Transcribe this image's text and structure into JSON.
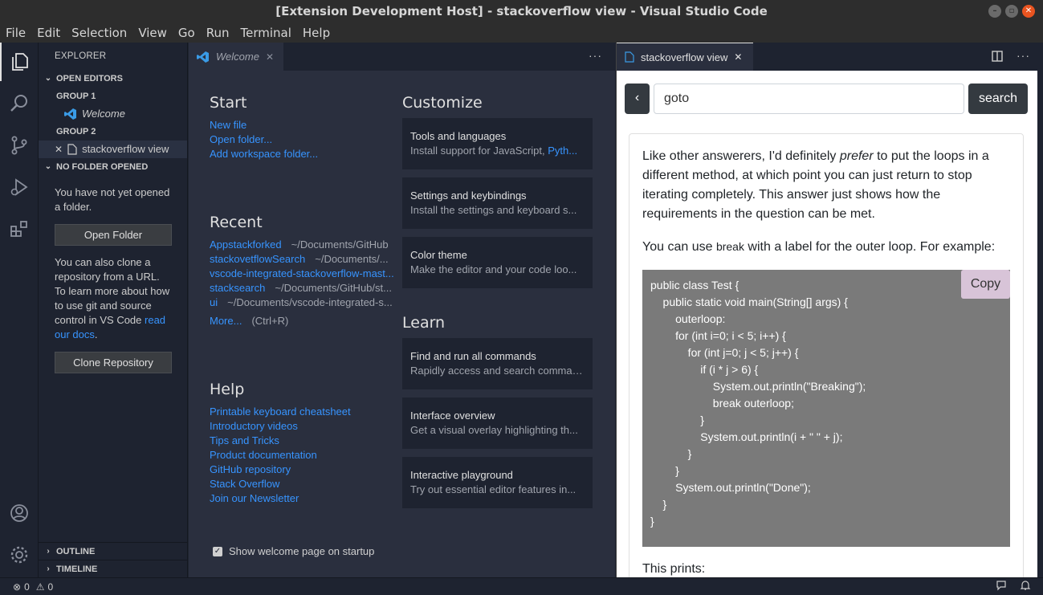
{
  "window": {
    "title": "[Extension Development Host] - stackoverflow view - Visual Studio Code"
  },
  "menu": [
    "File",
    "Edit",
    "Selection",
    "View",
    "Go",
    "Run",
    "Terminal",
    "Help"
  ],
  "sidebar": {
    "title": "EXPLORER",
    "open_editors": {
      "header": "OPEN EDITORS",
      "group1": "GROUP 1",
      "group1_item": "Welcome",
      "group2": "GROUP 2",
      "group2_item": "stackoverflow view"
    },
    "no_folder": {
      "header": "NO FOLDER OPENED",
      "text1": "You have not yet opened a folder.",
      "open_folder_btn": "Open Folder",
      "text2_pre": "You can also clone a repository from a URL. To learn more about how to use git and source control in VS Code ",
      "text2_link": "read our docs",
      "text2_post": ".",
      "clone_btn": "Clone Repository"
    },
    "outline": "OUTLINE",
    "timeline": "TIMELINE"
  },
  "editor1": {
    "tab_label": "Welcome",
    "start": {
      "heading": "Start",
      "links": [
        "New file",
        "Open folder...",
        "Add workspace folder..."
      ]
    },
    "recent": {
      "heading": "Recent",
      "items": [
        {
          "name": "Appstackforked",
          "path": "~/Documents/GitHub"
        },
        {
          "name": "stackovetflowSearch",
          "path": "~/Documents/..."
        },
        {
          "name": "vscode-integrated-stackoverflow-mast...",
          "path": ""
        },
        {
          "name": "stacksearch",
          "path": "~/Documents/GitHub/st..."
        },
        {
          "name": "ui",
          "path": "~/Documents/vscode-integrated-s..."
        }
      ],
      "more": "More...",
      "more_shortcut": "(Ctrl+R)"
    },
    "help": {
      "heading": "Help",
      "links": [
        "Printable keyboard cheatsheet",
        "Introductory videos",
        "Tips and Tricks",
        "Product documentation",
        "GitHub repository",
        "Stack Overflow",
        "Join our Newsletter"
      ]
    },
    "customize": {
      "heading": "Customize",
      "cards": [
        {
          "title": "Tools and languages",
          "desc": "Install support for JavaScript, ",
          "desc_link": "Pyth..."
        },
        {
          "title": "Settings and keybindings",
          "desc": "Install the settings and keyboard s..."
        },
        {
          "title": "Color theme",
          "desc": "Make the editor and your code loo..."
        }
      ]
    },
    "learn": {
      "heading": "Learn",
      "cards": [
        {
          "title": "Find and run all commands",
          "desc": "Rapidly access and search comman..."
        },
        {
          "title": "Interface overview",
          "desc": "Get a visual overlay highlighting th..."
        },
        {
          "title": "Interactive playground",
          "desc": "Try out essential editor features in..."
        }
      ]
    },
    "startup_checkbox": "Show welcome page on startup"
  },
  "editor2": {
    "tab_label": "stackoverflow view",
    "back_label": "‹",
    "search_value": "goto",
    "search_btn": "search",
    "answer": {
      "p1_a": "Like other answerers, I'd definitely ",
      "p1_em": "prefer",
      "p1_b": " to put the loops in a different method, at which point you can just return to stop iterating completely. This answer just shows how the requirements in the question can be met.",
      "p2_a": "You can use ",
      "p2_code": "break",
      "p2_b": " with a label for the outer loop. For example:",
      "code": "public class Test {\n    public static void main(String[] args) {\n        outerloop:\n        for (int i=0; i < 5; i++) {\n            for (int j=0; j < 5; j++) {\n                if (i * j > 6) {\n                    System.out.println(\"Breaking\");\n                    break outerloop;\n                }\n                System.out.println(i + \" \" + j);\n            }\n        }\n        System.out.println(\"Done\");\n    }\n}",
      "copy_btn": "Copy",
      "p3": "This prints:"
    }
  },
  "statusbar": {
    "errors": "0",
    "warnings": "0"
  }
}
